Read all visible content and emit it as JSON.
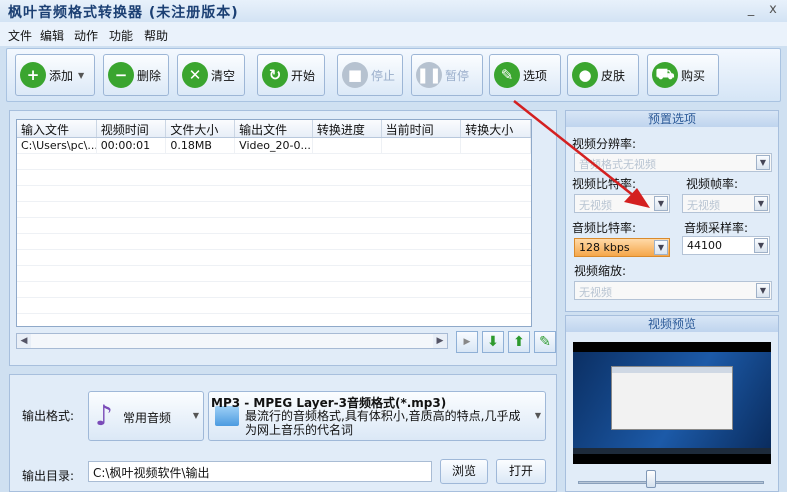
{
  "window": {
    "title": "枫叶音频格式转换器  (未注册版本)",
    "minimize": "_",
    "close": "x"
  },
  "menu": [
    "文件",
    "编辑",
    "动作",
    "功能",
    "帮助"
  ],
  "toolbar": {
    "add": "添加",
    "delete": "删除",
    "clear": "清空",
    "start": "开始",
    "stop": "停止",
    "pause": "暂停",
    "options": "选项",
    "skin": "皮肤",
    "buy": "购买"
  },
  "table": {
    "columns": [
      "输入文件",
      "视频时间",
      "文件大小",
      "输出文件",
      "转换进度",
      "当前时间",
      "转换大小"
    ],
    "rows": [
      [
        "C:\\Users\\pc\\...",
        "00:00:01",
        "0.18MB",
        "Video_20-0...",
        "",
        "",
        ""
      ]
    ]
  },
  "presets": {
    "title": "预置选项",
    "video_resolution_label": "视频分辨率:",
    "video_resolution_value": "音频格式无视频",
    "video_bitrate_label": "视频比特率:",
    "video_bitrate_value": "无视频",
    "video_fps_label": "视频帧率:",
    "video_fps_value": "无视频",
    "audio_bitrate_label": "音频比特率:",
    "audio_bitrate_value": "128 kbps",
    "audio_samplerate_label": "音频采样率:",
    "audio_samplerate_value": "44100",
    "video_scale_label": "视频缩放:",
    "video_scale_value": "无视频"
  },
  "preview": {
    "title": "视频预览"
  },
  "output": {
    "format_label": "输出格式:",
    "format_category": "常用音频",
    "format_title": "MP3 - MPEG Layer-3音频格式(*.mp3)",
    "format_description": "最流行的音频格式,具有体积小,音质高的特点,几乎成为网上音乐的代名词",
    "dir_label": "输出目录:",
    "dir_value": "C:\\枫叶视频软件\\输出",
    "browse": "浏览",
    "open": "打开"
  },
  "colors": {
    "accent_green": "#3aa52f",
    "arrow_red": "#d42020",
    "audio_bitrate_orange": "#f5a64a"
  }
}
